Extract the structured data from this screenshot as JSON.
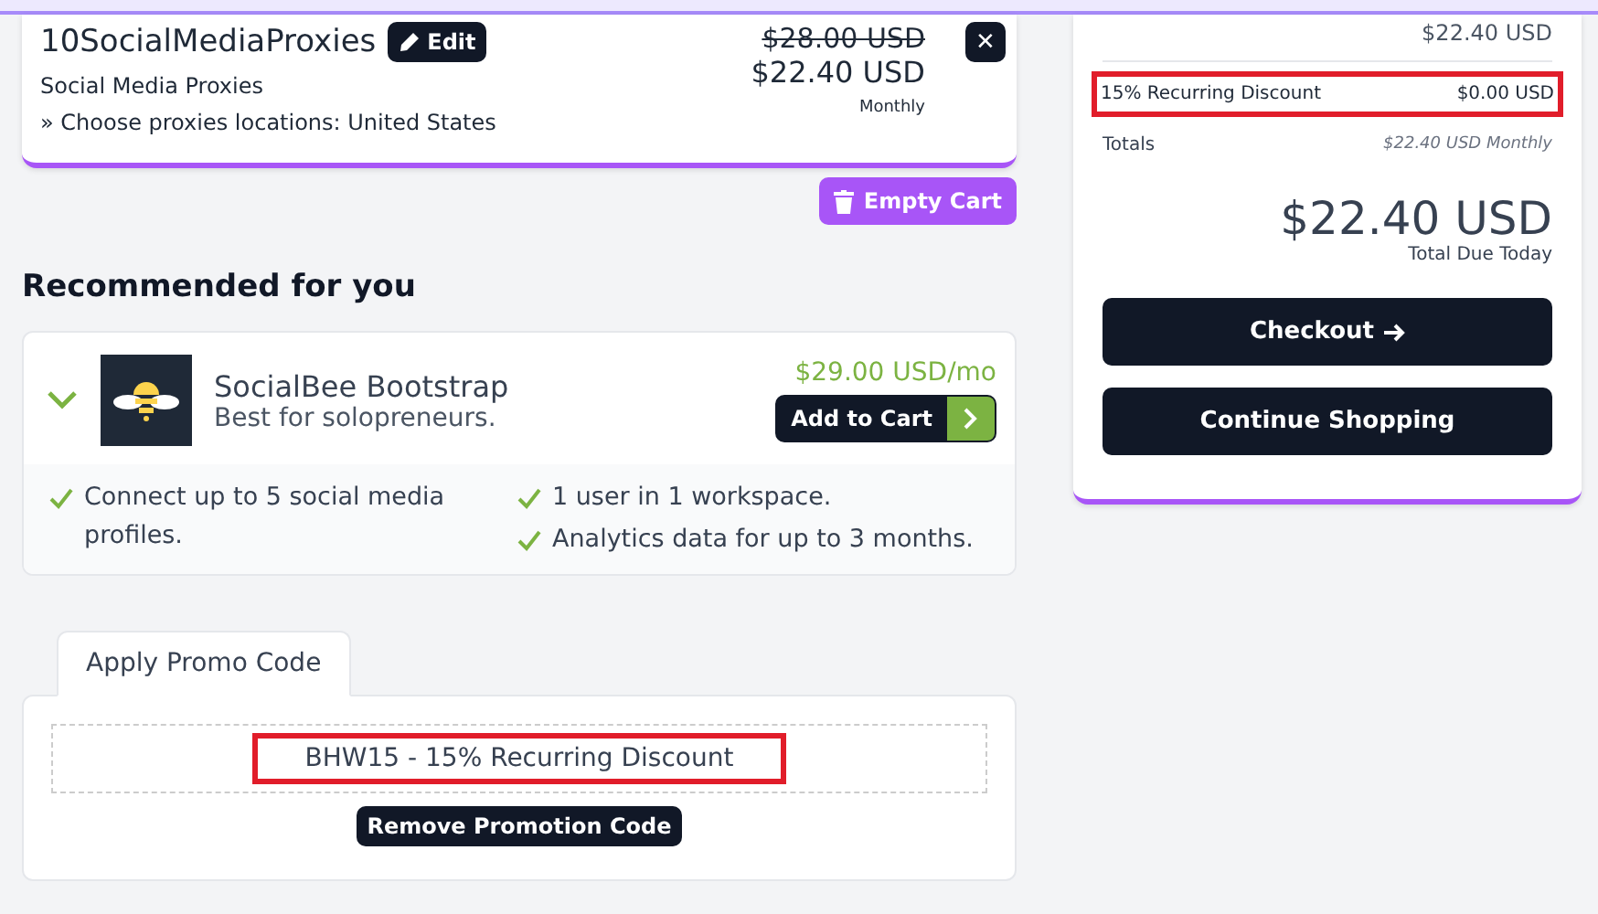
{
  "cart_item": {
    "name": "10SocialMediaProxies",
    "edit_label": "Edit",
    "group": "Social Media Proxies",
    "option": "» Choose proxies locations: United States",
    "old_price": "$28.00 USD",
    "price": "$22.40 USD",
    "cycle": "Monthly",
    "remove_label": "✕"
  },
  "empty_cart_label": "Empty Cart",
  "recommended": {
    "heading": "Recommended for you",
    "product": {
      "name": "SocialBee Bootstrap",
      "tagline": "Best for solopreneurs.",
      "price": "$29.00 USD/mo",
      "button": "Add to Cart",
      "expanded": true,
      "features": [
        {
          "text": "Connect up to 5 social media profiles."
        },
        {
          "text": "1 user in 1 workspace."
        },
        {
          "text": "Analytics data for up to 3 months."
        }
      ]
    }
  },
  "promo": {
    "tabs": [
      {
        "label": "Apply Promo Code",
        "selected": true
      }
    ],
    "applied_code": "BHW15 - 15% Recurring Discount",
    "highlighted": true,
    "remove_label": "Remove Promotion Code"
  },
  "summary": {
    "subtotal": "$22.40 USD",
    "discount": {
      "label": "15% Recurring Discount",
      "amount": "$0.00 USD",
      "highlighted": true
    },
    "totals_label": "Totals",
    "recurring": "$22.40 USD Monthly",
    "total": "$22.40 USD",
    "total_caption": "Total Due Today",
    "checkout_label": "Checkout",
    "continue_label": "Continue Shopping"
  }
}
